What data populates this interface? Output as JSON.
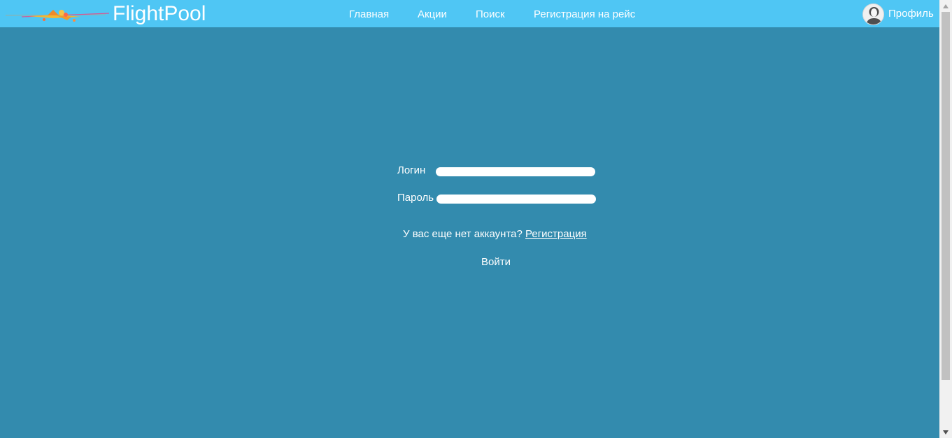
{
  "header": {
    "brand": "FlightPool",
    "nav": [
      {
        "label": "Главная"
      },
      {
        "label": "Акции"
      },
      {
        "label": "Поиск"
      },
      {
        "label": "Регистрация на рейс"
      }
    ],
    "profile_label": "Профиль"
  },
  "form": {
    "login_label": "Логин",
    "login_value": "",
    "password_label": "Пароль",
    "password_value": "",
    "no_account_text": "У вас еще нет аккаунта?",
    "register_link": "Регистрация",
    "submit_label": "Войти"
  },
  "colors": {
    "header": "#4fc6f4",
    "background": "#338bae",
    "text": "#ffffff"
  }
}
